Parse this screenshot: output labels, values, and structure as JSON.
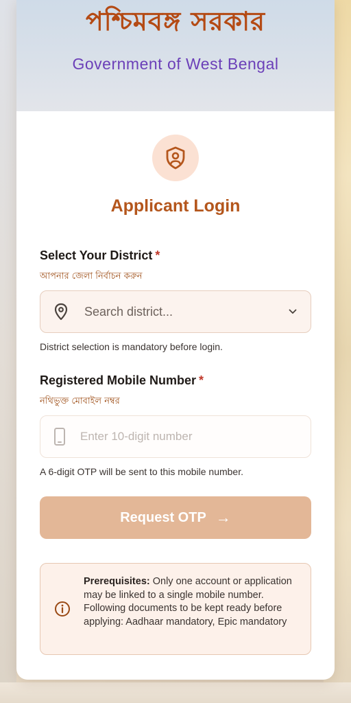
{
  "header": {
    "title_bn": "পশ্চিমবঙ্গ সরকার",
    "title_en": "Government of West Bengal"
  },
  "login": {
    "title": "Applicant Login",
    "icon": "shield-user-icon"
  },
  "district": {
    "label": "Select Your District",
    "required_mark": "*",
    "sublabel_bn": "আপনার জেলা নির্বাচন করুন",
    "placeholder": "Search district...",
    "help": "District selection is mandatory before login."
  },
  "mobile": {
    "label": "Registered Mobile Number",
    "required_mark": "*",
    "sublabel_bn": "নথিভুক্ত মোবাইল নম্বর",
    "placeholder": "Enter 10-digit number",
    "help": "A 6-digit OTP will be sent to this mobile number."
  },
  "otp_button": {
    "label": "Request OTP",
    "arrow": "→"
  },
  "notice": {
    "heading": "Prerequisites:",
    "body": " Only one account or application may be linked to a single mobile number. Following documents to be kept ready before applying: Aadhaar mandatory, Epic mandatory"
  },
  "colors": {
    "accent": "#b4561c",
    "button": "#e3b797",
    "required": "#c0392b"
  }
}
